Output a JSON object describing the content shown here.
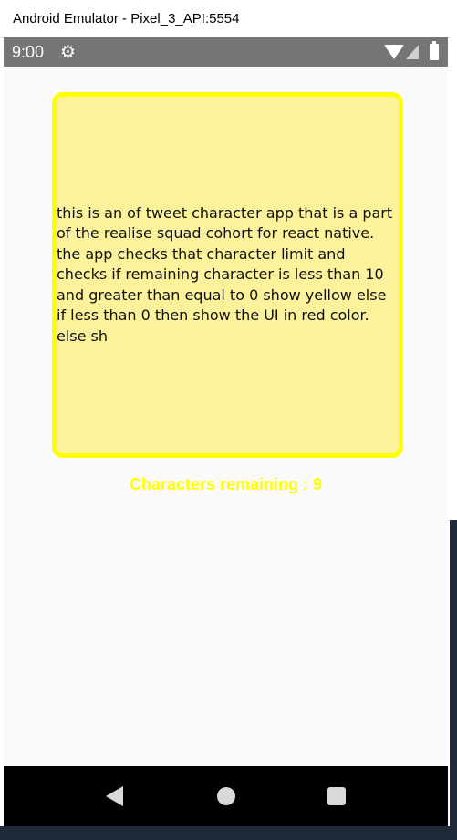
{
  "window": {
    "title": "Android Emulator - Pixel_3_API:5554"
  },
  "statusbar": {
    "time": "9:00",
    "icons": [
      "gear-icon",
      "wifi-icon",
      "cell-signal-icon",
      "battery-icon"
    ]
  },
  "app": {
    "tweet_text": "this is an of tweet character app that is a part of the realise squad cohort for react native. the app checks that character limit and checks if remaining character is less than 10 and greater than equal to 0 show yellow else if less than 0 then show the UI in red color. else sh",
    "characters_remaining": "Characters remaining : 9",
    "colors": {
      "box_border": "#ffff00",
      "box_fill": "#fbf29b",
      "counter_text": "#ffff00"
    }
  },
  "navbar": {
    "icons": [
      "back-icon",
      "home-icon",
      "recents-icon"
    ]
  }
}
